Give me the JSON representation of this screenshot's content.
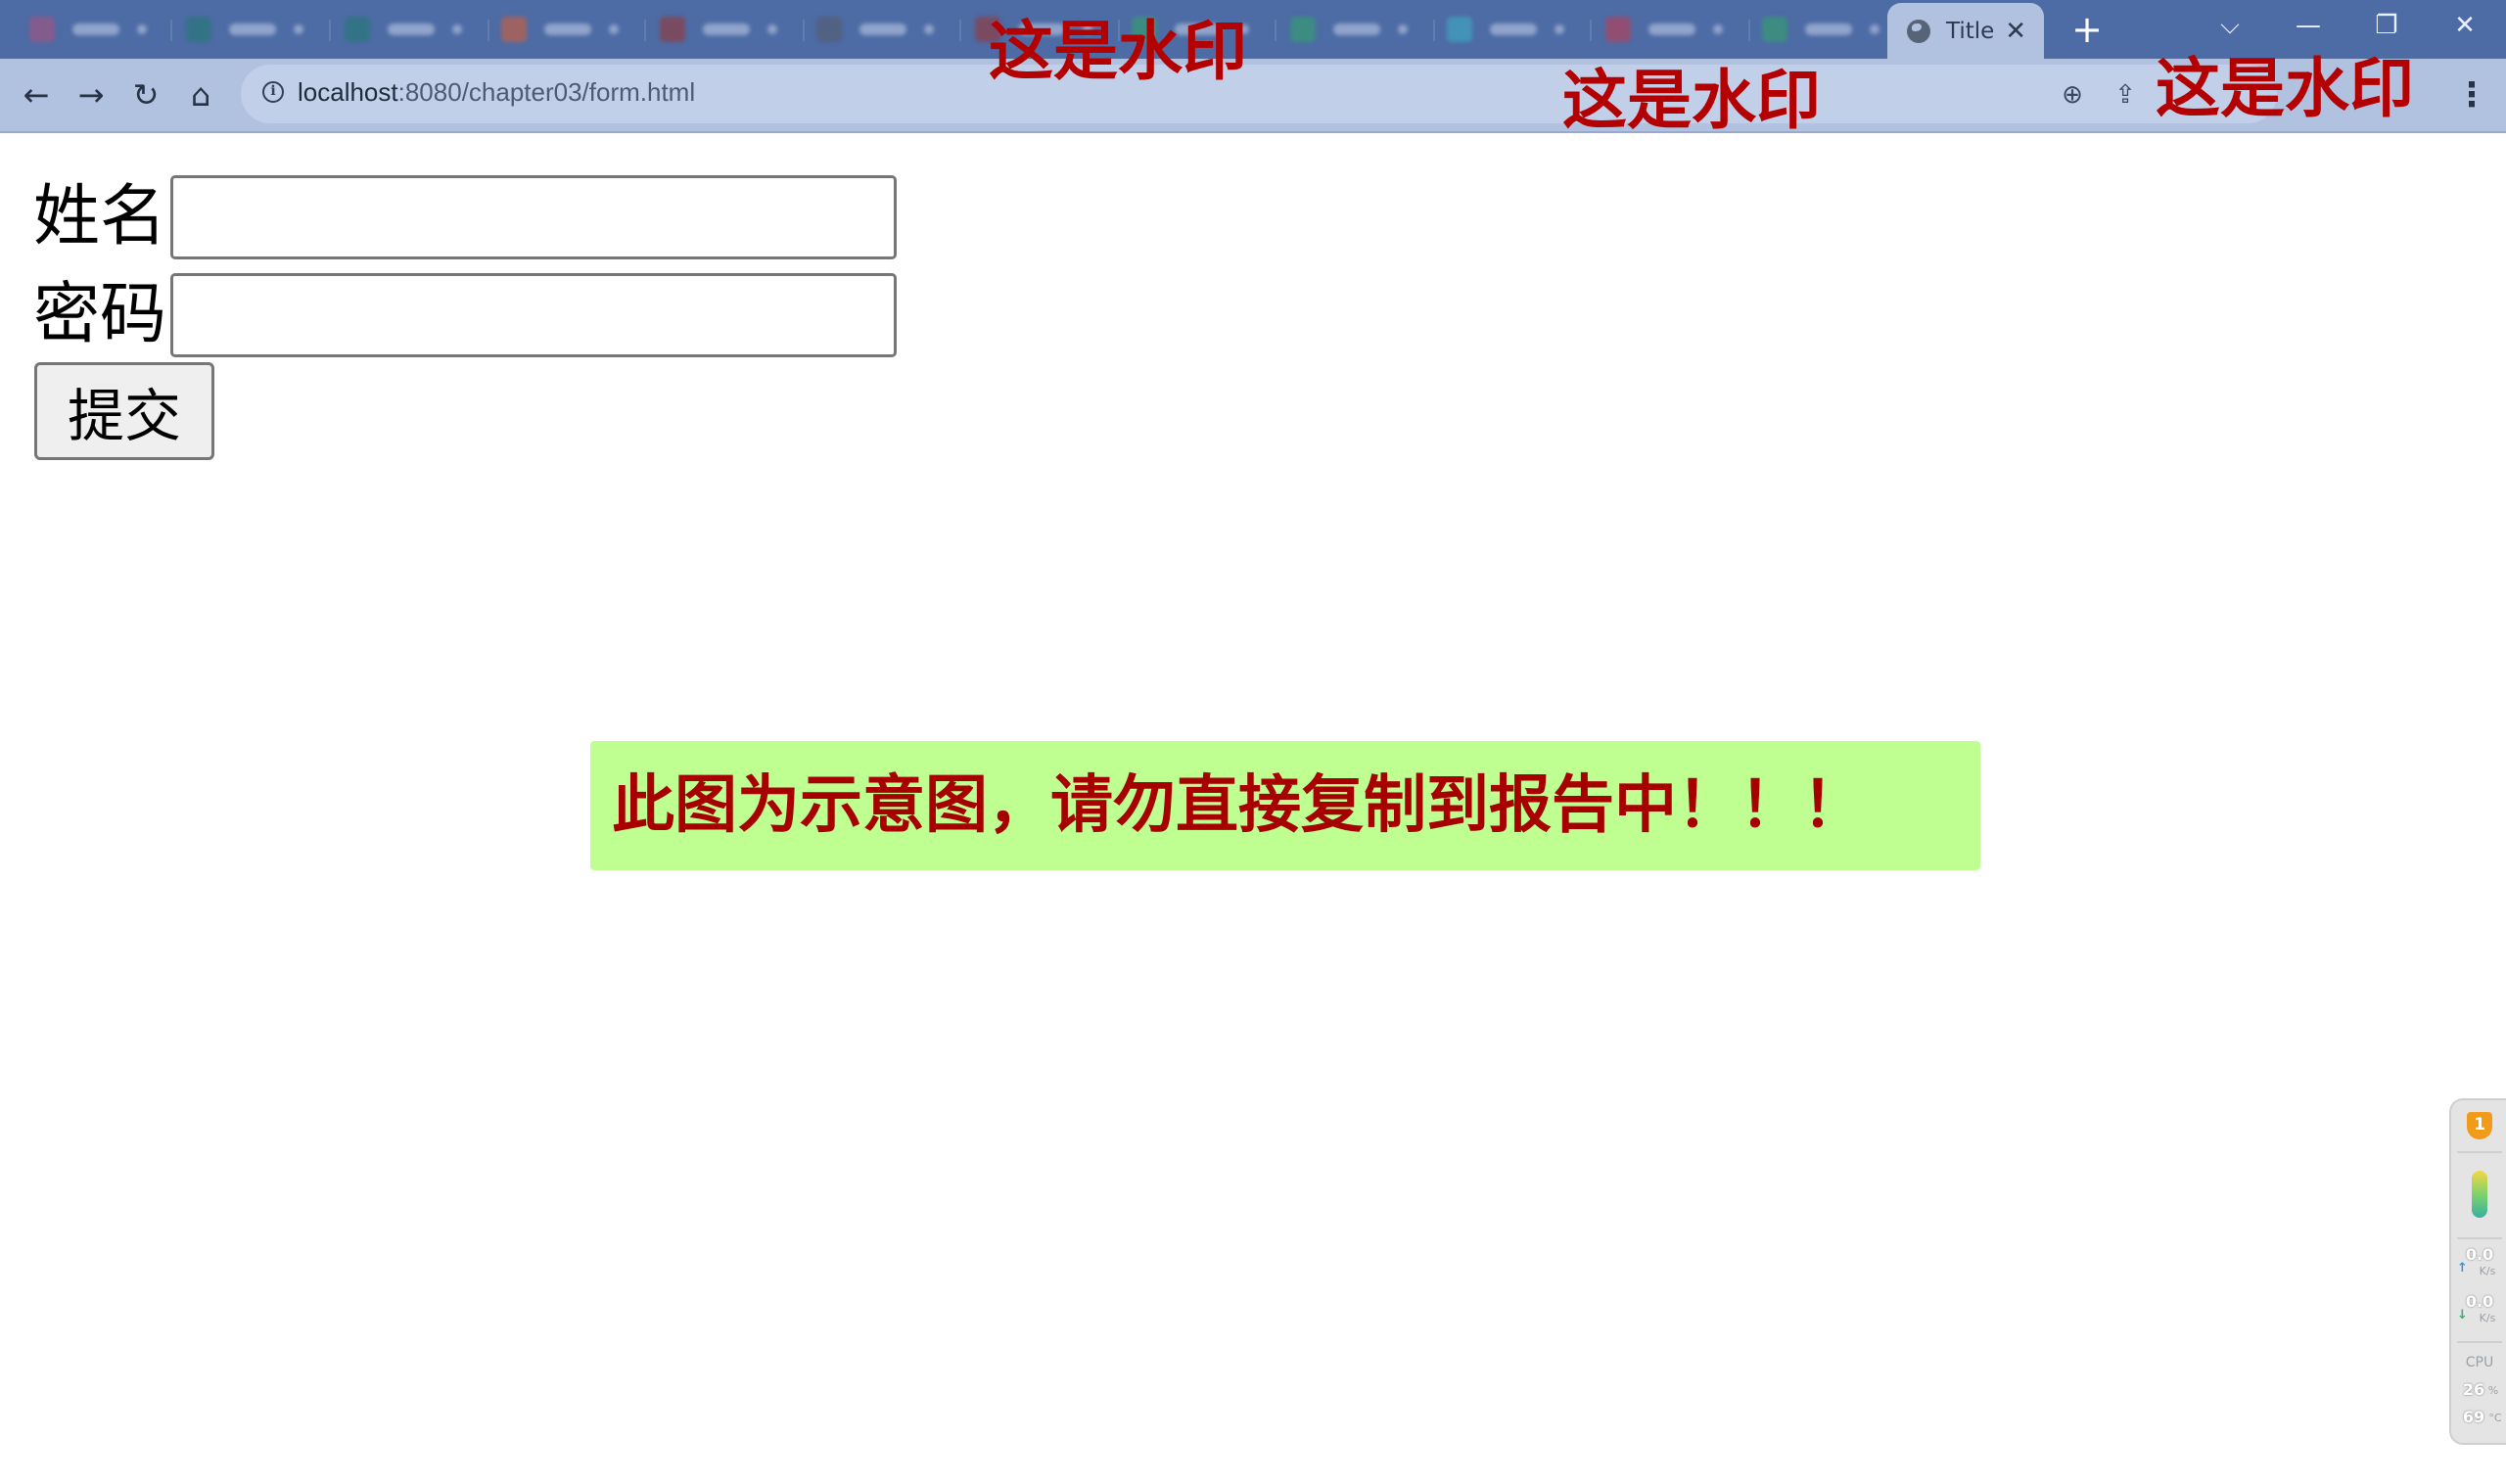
{
  "browser": {
    "active_tab_title": "Title",
    "tab_close_glyph": "✕",
    "new_tab_glyph": "+",
    "url_host": "localhost",
    "url_rest": ":8080/chapter03/form.html",
    "window_controls": {
      "list": "⌵",
      "minimize": "—",
      "restore": "❐",
      "close": "✕"
    },
    "nav_glyphs": {
      "back": "←",
      "forward": "→",
      "reload": "↻",
      "home": "⌂",
      "menu": "⋮"
    },
    "omnibox_glyphs": {
      "zoom": "⊕",
      "share": "⇪"
    }
  },
  "form": {
    "name_label": "姓名",
    "name_value": "",
    "password_label": "密码",
    "password_value": "",
    "submit_label": "提交"
  },
  "notice": {
    "text": "此图为示意图，请勿直接复制到报告中！！！",
    "background": "#bfff91",
    "text_color": "#a60000"
  },
  "watermarks": [
    "这是水印",
    "这是水印",
    "这是水印"
  ],
  "monitor": {
    "badge": "1",
    "upload_value": "0.0",
    "upload_unit": "K/s",
    "download_value": "0.0",
    "download_unit": "K/s",
    "cpu_label": "CPU",
    "cpu_value": "26",
    "cpu_unit": "%",
    "temp_value": "69",
    "temp_unit": "°C"
  },
  "colors": {
    "tabstrip": "#4d6ba5",
    "toolbar": "#b1c1e0",
    "watermark": "#b30000"
  }
}
